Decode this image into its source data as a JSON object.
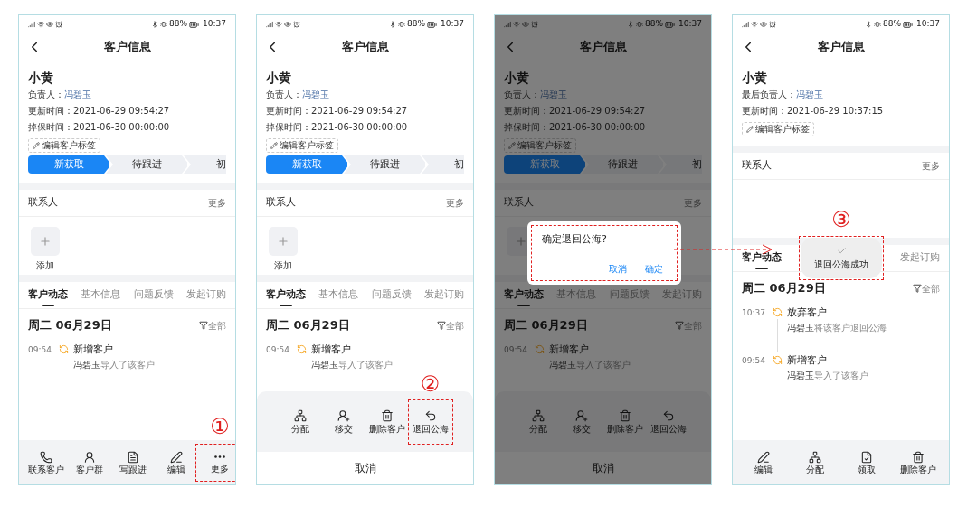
{
  "screens": [
    {
      "status_bar": {
        "battery": "88%",
        "time": "10:37"
      },
      "title": "客户信息",
      "customer": {
        "name": "小黄",
        "fields": [
          {
            "label": "负责人：",
            "value": "冯碧玉",
            "kind": "link"
          },
          {
            "label": "更新时间：",
            "value": "2021-06-29 09:54:27",
            "kind": "text"
          },
          {
            "label": "掉保时间：",
            "value": "2021-06-30 00:00:00",
            "kind": "text"
          }
        ],
        "tag_button": "编辑客户标签"
      },
      "stages": [
        {
          "label": "新获取",
          "selected": true
        },
        {
          "label": "待跟进",
          "selected": false
        },
        {
          "label": "初",
          "selected": false
        }
      ],
      "contacts": {
        "title": "联系人",
        "more": "更多",
        "add_tile": true,
        "add_label": "添加"
      },
      "tabs": [
        {
          "label": "客户动态",
          "selected": true
        },
        {
          "label": "基本信息",
          "selected": false
        },
        {
          "label": "问题反馈",
          "selected": false
        },
        {
          "label": "发起订购",
          "selected": false
        }
      ],
      "timeline": {
        "date": "周二 06月29日",
        "filter": "全部",
        "events": [
          {
            "time": "09:54",
            "title": "新增客户",
            "description": "**冯碧玉**导入了该客户"
          }
        ]
      },
      "bottom_bar": [
        {
          "label": "联系客户",
          "kind": "phone",
          "highlighted": false
        },
        {
          "label": "客户群",
          "kind": "user",
          "highlighted": false
        },
        {
          "label": "写跟进",
          "kind": "document",
          "highlighted": false
        },
        {
          "label": "编辑",
          "kind": "pen",
          "highlighted": false
        },
        {
          "label": "更多",
          "kind": "more",
          "highlighted": true,
          "marker": "①"
        }
      ]
    },
    {
      "status_bar": {
        "battery": "88%",
        "time": "10:37"
      },
      "title": "客户信息",
      "customer": {
        "name": "小黄",
        "fields": [
          {
            "label": "负责人：",
            "value": "冯碧玉",
            "kind": "link"
          },
          {
            "label": "更新时间：",
            "value": "2021-06-29 09:54:27",
            "kind": "text"
          },
          {
            "label": "掉保时间：",
            "value": "2021-06-30 00:00:00",
            "kind": "text"
          }
        ],
        "tag_button": "编辑客户标签"
      },
      "stages": [
        {
          "label": "新获取",
          "selected": true
        },
        {
          "label": "待跟进",
          "selected": false
        },
        {
          "label": "初",
          "selected": false
        }
      ],
      "contacts": {
        "title": "联系人",
        "more": "更多",
        "add_tile": true,
        "add_label": "添加"
      },
      "tabs": [
        {
          "label": "客户动态",
          "selected": true
        },
        {
          "label": "基本信息",
          "selected": false
        },
        {
          "label": "问题反馈",
          "selected": false
        },
        {
          "label": "发起订购",
          "selected": false
        }
      ],
      "timeline": {
        "date": "周二 06月29日",
        "filter": "全部",
        "events": [
          {
            "time": "09:54",
            "title": "新增客户",
            "description": "**冯碧玉**导入了该客户"
          }
        ]
      },
      "action_sheet": {
        "items": [
          {
            "label": "分配",
            "kind": "network",
            "highlighted": false
          },
          {
            "label": "移交",
            "kind": "user-share",
            "highlighted": false
          },
          {
            "label": "删除客户",
            "kind": "trash",
            "highlighted": false
          },
          {
            "label": "退回公海",
            "kind": "undo",
            "highlighted": true,
            "marker": "②"
          }
        ],
        "cancel": "取消"
      }
    },
    {
      "status_bar": {
        "battery": "88%",
        "time": "10:37"
      },
      "title": "客户信息",
      "customer": {
        "name": "小黄",
        "fields": [
          {
            "label": "负责人：",
            "value": "冯碧玉",
            "kind": "link"
          },
          {
            "label": "更新时间：",
            "value": "2021-06-29 09:54:27",
            "kind": "text"
          },
          {
            "label": "掉保时间：",
            "value": "2021-06-30 00:00:00",
            "kind": "text"
          }
        ],
        "tag_button": "编辑客户标签"
      },
      "stages": [
        {
          "label": "新获取",
          "selected": true
        },
        {
          "label": "待跟进",
          "selected": false
        },
        {
          "label": "初",
          "selected": false
        }
      ],
      "contacts": {
        "title": "联系人",
        "more": "更多",
        "add_tile": true
      },
      "tabs": [
        {
          "label": "客户动态",
          "selected": true
        },
        {
          "label": "基本信息",
          "selected": false
        },
        {
          "label": "问题反馈",
          "selected": false
        },
        {
          "label": "发起订购",
          "selected": false
        }
      ],
      "timeline": {
        "date": "周二 06月29日",
        "filter": "全部",
        "events": [
          {
            "time": "09:54",
            "title": "新增客户",
            "description": "**冯碧玉**导入了该客户"
          }
        ]
      },
      "action_sheet": {
        "items": [
          {
            "label": "分配",
            "kind": "network",
            "highlighted": false
          },
          {
            "label": "移交",
            "kind": "user-share",
            "highlighted": false
          },
          {
            "label": "删除客户",
            "kind": "trash",
            "highlighted": false
          },
          {
            "label": "退回公海",
            "kind": "undo",
            "highlighted": false
          }
        ],
        "cancel": "取消"
      },
      "dialog": {
        "message": "确定退回公海?",
        "cancel": "取消",
        "confirm": "确定",
        "highlighted": true,
        "arrow_to_next": true
      }
    },
    {
      "status_bar": {
        "battery": "88%",
        "time": "10:37"
      },
      "title": "客户信息",
      "customer": {
        "name": "小黄",
        "fields": [
          {
            "label": "最后负责人：",
            "value": "冯碧玉",
            "kind": "link"
          },
          {
            "label": "更新时间：",
            "value": "2021-06-29 10:37:15",
            "kind": "text"
          }
        ],
        "tag_button": "编辑客户标签"
      },
      "contacts": {
        "title": "联系人",
        "more": "更多",
        "add_tile": false
      },
      "tabs": [
        {
          "label": "客户动态",
          "selected": true
        },
        {
          "label": "发起订购",
          "selected": false
        }
      ],
      "timeline": {
        "date": "周二 06月29日",
        "filter": "全部",
        "events": [
          {
            "time": "10:37",
            "title": "放弃客户",
            "description": "**冯碧玉**将该客户退回公海"
          },
          {
            "time": "09:54",
            "title": "新增客户",
            "description": "**冯碧玉**导入了该客户"
          }
        ]
      },
      "toast": {
        "text": "退回公海成功",
        "highlighted": true,
        "marker": "③"
      },
      "bottom_bar": [
        {
          "label": "编辑",
          "kind": "pen",
          "highlighted": false
        },
        {
          "label": "分配",
          "kind": "network",
          "highlighted": false
        },
        {
          "label": "领取",
          "kind": "file-check",
          "highlighted": false
        },
        {
          "label": "删除客户",
          "kind": "trash",
          "highlighted": false
        }
      ]
    }
  ]
}
